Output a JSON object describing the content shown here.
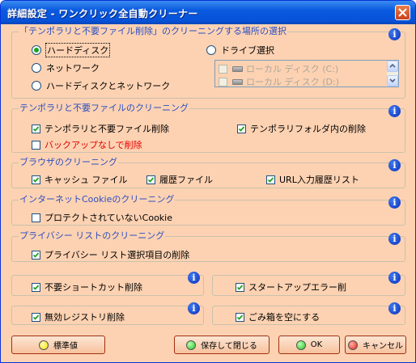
{
  "window": {
    "title": "詳細設定 - ワンクリック全自動クリーナー"
  },
  "sections": {
    "location": {
      "legend": "「テンポラリと不要ファイル削除」のクリーニングする場所の選択",
      "radio_hdd": "ハードディスク",
      "radio_network": "ネットワーク",
      "radio_hdd_network": "ハードディスクとネットワーク",
      "radio_drive": "ドライブ選択",
      "drives": [
        "ローカル ディスク (C:)",
        "ローカル ディスク (D:)"
      ],
      "selected": "ハードディスク"
    },
    "temp": {
      "legend": "テンポラリと不要ファイルのクリーニング",
      "temp_delete": {
        "label": "テンポラリと不要ファイル削除",
        "checked": true
      },
      "temp_folder": {
        "label": "テンポラリフォルダ内の削除",
        "checked": true
      },
      "no_backup": {
        "label": "バックアップなしで削除",
        "checked": false
      }
    },
    "browser": {
      "legend": "ブラウザのクリーニング",
      "cache": {
        "label": "キャッシュ ファイル",
        "checked": true
      },
      "history": {
        "label": "履歴ファイル",
        "checked": true
      },
      "url": {
        "label": "URL入力履歴リスト",
        "checked": true
      }
    },
    "cookie": {
      "legend": "インターネットCookieのクリーニング",
      "unprotected": {
        "label": "プロテクトされていないCookie",
        "checked": false
      }
    },
    "privacy": {
      "legend": "プライバシー リストのクリーニング",
      "selected_items": {
        "label": "プライバシー リスト選択項目の削除",
        "checked": true
      }
    },
    "shortcut": {
      "label": "不要ショートカット削除",
      "checked": true
    },
    "startup": {
      "label": "スタートアップエラー削",
      "checked": true
    },
    "registry": {
      "label": "無効レジストリ削除",
      "checked": true
    },
    "trash": {
      "label": "ごみ箱を空にする",
      "checked": true
    }
  },
  "buttons": {
    "default": "標準値",
    "save_close": "保存して閉じる",
    "ok": "OK",
    "cancel": "キャンセル"
  },
  "colors": {
    "titlebar": "#0a5ae0",
    "background": "#fdd2b2",
    "legend": "#2a4fc0",
    "warning_text": "#e00000",
    "led_yellow": "#f5e800",
    "led_green": "#22c822",
    "led_red": "#e82020"
  },
  "icons": [
    "info-icon",
    "check-icon",
    "close-icon",
    "drive-icon",
    "scroll-up-icon",
    "scroll-down-icon"
  ]
}
